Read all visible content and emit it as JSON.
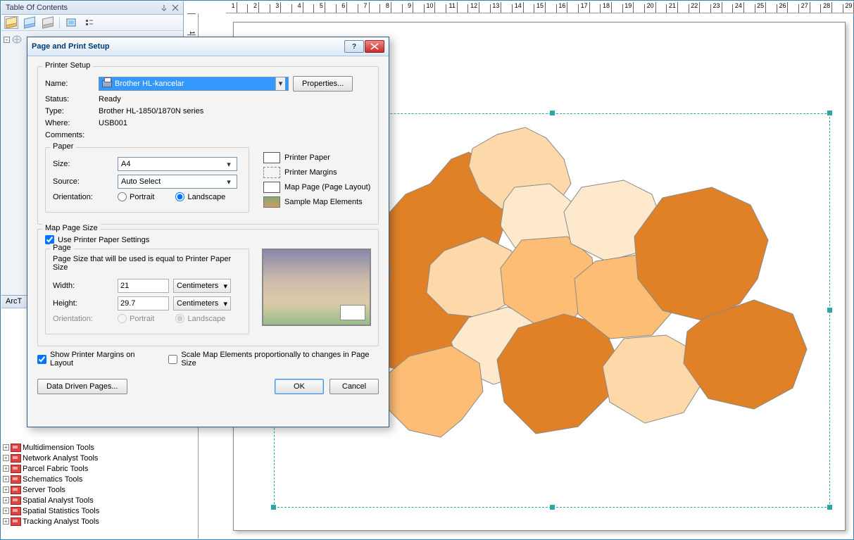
{
  "toc": {
    "title": "Table Of Contents"
  },
  "ruler": {
    "ticks": [
      "1",
      "",
      "2",
      "",
      "3",
      "",
      "4",
      "",
      "5",
      "",
      "6",
      "",
      "7",
      "",
      "8",
      "",
      "9",
      "",
      "10",
      "",
      "11",
      "",
      "12",
      "",
      "13",
      "",
      "14",
      "",
      "15",
      "",
      "16",
      "",
      "17",
      "",
      "18",
      "",
      "19",
      "",
      "20",
      "",
      "21",
      "",
      "22",
      "",
      "23",
      "",
      "24",
      "",
      "25",
      "",
      "26",
      "",
      "27",
      "",
      "28",
      "",
      "29"
    ]
  },
  "toolbox": {
    "title": "ArcT",
    "items": [
      "Multidimension Tools",
      "Network Analyst Tools",
      "Parcel Fabric Tools",
      "Schematics Tools",
      "Server Tools",
      "Spatial Analyst Tools",
      "Spatial Statistics Tools",
      "Tracking Analyst Tools"
    ]
  },
  "dialog": {
    "title": "Page and Print Setup",
    "printer_setup": {
      "legend": "Printer Setup",
      "name_label": "Name:",
      "name_value": "Brother HL-kancelar",
      "properties_btn": "Properties...",
      "status_label": "Status:",
      "status_value": "Ready",
      "type_label": "Type:",
      "type_value": "Brother HL-1850/1870N series",
      "where_label": "Where:",
      "where_value": "USB001",
      "comments_label": "Comments:"
    },
    "paper": {
      "legend": "Paper",
      "size_label": "Size:",
      "size_value": "A4",
      "source_label": "Source:",
      "source_value": "Auto Select",
      "orientation_label": "Orientation:",
      "portrait": "Portrait",
      "landscape": "Landscape"
    },
    "legend_items": {
      "printer_paper": "Printer Paper",
      "printer_margins": "Printer Margins",
      "map_page": "Map Page (Page Layout)",
      "sample": "Sample Map Elements"
    },
    "map_page_size": {
      "legend": "Map Page Size",
      "use_printer": "Use Printer Paper Settings",
      "page_legend": "Page",
      "hint": "Page Size that will be used is equal to Printer Paper Size",
      "width_label": "Width:",
      "width_value": "21",
      "height_label": "Height:",
      "height_value": "29.7",
      "units": "Centimeters",
      "orientation_label": "Orientation:"
    },
    "show_margins": "Show Printer Margins on Layout",
    "scale_elements": "Scale Map Elements proportionally to changes in Page Size",
    "data_driven": "Data Driven Pages...",
    "ok": "OK",
    "cancel": "Cancel"
  }
}
